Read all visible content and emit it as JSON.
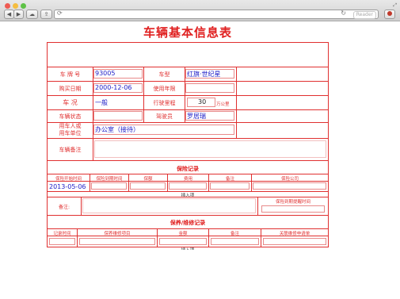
{
  "browser": {
    "reader_label": "Reader"
  },
  "page": {
    "title": "车辆基本信息表",
    "fields": {
      "plate_label": "车 牌 号",
      "plate_value": "93005",
      "model_label": "车型",
      "model_value": "红旗·世纪星",
      "purchase_label": "购买日期",
      "purchase_value": "2000-12-06",
      "years_label": "使用年限",
      "condition_label": "车   况",
      "condition_value": "一般",
      "mileage_label": "行驶里程",
      "mileage_value": "30",
      "mileage_unit": "万公里",
      "status_label": "车辆状态",
      "driver_label": "驾驶员",
      "driver_value": "罗居瑞",
      "user_label_1": "用车人或",
      "user_label_2": "用车单位",
      "user_value": "办公室（接待）",
      "remark_label": "车辆备注"
    },
    "insurance": {
      "title": "保险记录",
      "headers": [
        "保险开始时间",
        "保险到期时间",
        "保额",
        "费用",
        "备注",
        "保险公司"
      ],
      "start_value": "2013-05-06",
      "insert_label": "插入项",
      "note_label": "备注:",
      "reminder_label": "保险到期提醒时间"
    },
    "maintenance": {
      "title": "保养/维修记录",
      "headers": [
        "记录时间",
        "保养维修项目",
        "金额",
        "备注",
        "关联维修申请单"
      ],
      "insert_label": "插入项"
    }
  }
}
